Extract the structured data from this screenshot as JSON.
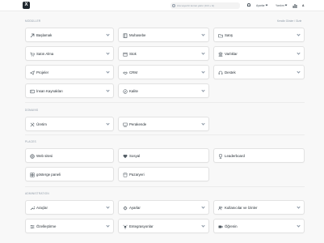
{
  "topbar": {
    "logo": "X",
    "search_placeholder": "Ara veya bir komut yazın (Ctrl + G)",
    "settings_menu": "Ayarlar",
    "help_menu": "Yardım",
    "avatar_initial": "A"
  },
  "sections": {
    "modules": {
      "title": "MODÜLLER",
      "action": "Kendin Göster / Gizle"
    },
    "domains": {
      "title": "DOMAINS"
    },
    "places": {
      "title": "PLACES"
    },
    "administration": {
      "title": "ADMINISTRATION"
    }
  },
  "cards": {
    "baslamak": "Başlamak",
    "muhasebe": "Muhasebe",
    "satis": "Satış",
    "satin_alma": "Satın Alma",
    "stok": "Stok",
    "varliklar": "Varlıklar",
    "projeler": "Projeler",
    "crm": "CRM",
    "destek": "Destek",
    "insan_kaynaklari": "İnsan Kaynakları",
    "kalite": "Kalite",
    "uretim": "Üretim",
    "perakende": "Perakende",
    "web_sitesi": "Web sitesi",
    "sosyal": "Sosyal",
    "leaderboard": "Leaderboard",
    "gosterge_paneli": "gösterge paneli",
    "pazaryeri": "Pazaryeri",
    "araclar": "Araçlar",
    "ayarlar": "Ayarlar",
    "kullanicilar": "Kullanıcılar ve İzinler",
    "ozellestirme": "Özelleştirme",
    "entegrasyonlar": "Entegrasyonlar",
    "ogrenin": "Öğrenin"
  }
}
